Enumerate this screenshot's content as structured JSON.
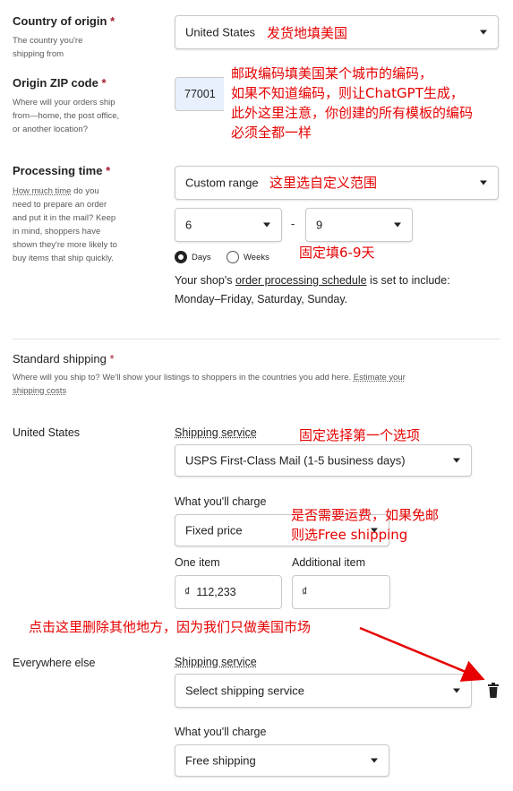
{
  "country": {
    "label": "Country of origin",
    "req": "*",
    "hint": "The country you're shipping from",
    "value": "United States"
  },
  "zip": {
    "label": "Origin ZIP code",
    "req": "*",
    "hint": "Where will your orders ship from—home, the post office, or another location?",
    "value": "77001"
  },
  "processing": {
    "label": "Processing time",
    "req": "*",
    "hint_link": "How much time",
    "hint_rest": " do you need to prepare an order and put it in the mail? Keep in mind, shoppers have shown they're more likely to buy items that ship quickly.",
    "range_value": "Custom range",
    "min_value": "6",
    "dash": "-",
    "max_value": "9",
    "unit_days": "Days",
    "unit_weeks": "Weeks",
    "selected_unit": "Days",
    "schedule_prefix": "Your shop's ",
    "schedule_link": "order processing schedule",
    "schedule_suffix": " is set to include:",
    "schedule_days": "Monday–Friday, Saturday, Sunday."
  },
  "standard_shipping": {
    "label": "Standard shipping",
    "req": "*",
    "hint": "Where will you ship to? We'll show your listings to shoppers in the countries you add here. ",
    "hint_link_1": "Estimate your",
    "hint_link_2": "shipping costs"
  },
  "us": {
    "region": "United States",
    "service_label": "Shipping service",
    "service_value": "USPS First-Class Mail (1-5 business days)",
    "charge_label": "What you'll charge",
    "charge_value": "Fixed price",
    "one_item_label": "One item",
    "additional_label": "Additional item",
    "currency": "₫",
    "one_item_value": "112,233",
    "additional_value": ""
  },
  "else": {
    "region": "Everywhere else",
    "service_label": "Shipping service",
    "service_value": "Select shipping service",
    "charge_label": "What you'll charge",
    "charge_value": "Free shipping"
  },
  "notes": {
    "country": "发货地填美国",
    "zip": [
      "邮政编码填美国某个城市的编码，",
      "如果不知道编码，则让ChatGPT生成，",
      "此外这里注意，你创建的所有模板的编码",
      "必须全都一样"
    ],
    "range": "这里选自定义范围",
    "fixed": "固定填6-9天",
    "service": "固定选择第一个选项",
    "charge": [
      "是否需要运费，如果免邮",
      "则选Free shipping"
    ],
    "delete": "点击这里删除其他地方，因为我们只做美国市场"
  },
  "colors": {
    "required": "#a61a2e",
    "annotation": "#e60000",
    "zip_field_bg": "#e8f0fe"
  },
  "icons": {
    "delete": "trash-icon",
    "dropdown": "chevron-down-icon"
  }
}
